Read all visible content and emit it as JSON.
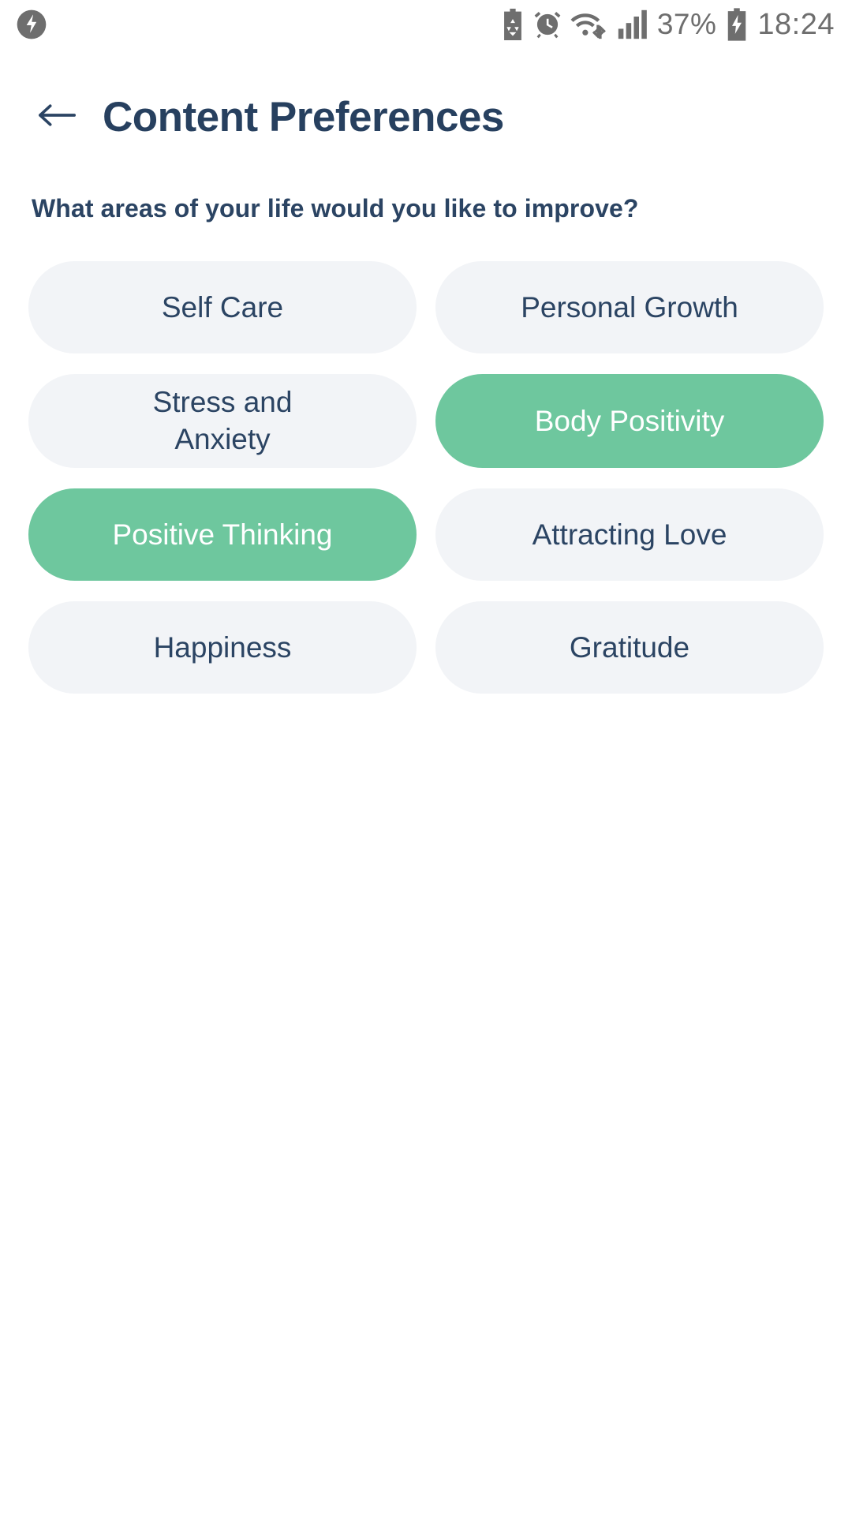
{
  "statusbar": {
    "notification_icon": "broken-bolt-circle-icon",
    "icons": [
      "battery-saver-icon",
      "alarm-clock-icon",
      "wifi-transfer-icon",
      "cellular-signal-icon"
    ],
    "battery_percent": "37%",
    "battery_icon": "battery-charging-icon",
    "time": "18:24",
    "color": "#6e6e6e"
  },
  "header": {
    "back_icon": "back-arrow-icon",
    "title": "Content Preferences"
  },
  "main": {
    "question": "What areas of your life would you like to improve?",
    "chips": [
      {
        "label": "Self Care",
        "selected": false
      },
      {
        "label": "Personal Growth",
        "selected": false
      },
      {
        "label": "Stress and Anxiety",
        "selected": false
      },
      {
        "label": "Body Positivity",
        "selected": true
      },
      {
        "label": "Positive Thinking",
        "selected": true
      },
      {
        "label": "Attracting Love",
        "selected": false
      },
      {
        "label": "Happiness",
        "selected": false
      },
      {
        "label": "Gratitude",
        "selected": false
      }
    ]
  },
  "theme": {
    "accent": "#6ec79e",
    "chip_background": "#f2f4f7",
    "text_navy": "#2b4463",
    "page_background": "#ffffff"
  }
}
